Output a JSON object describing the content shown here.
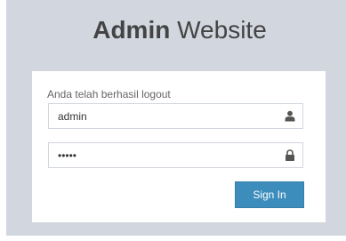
{
  "logo": {
    "bold": "Admin",
    "light": "Website"
  },
  "login": {
    "message": "Anda telah berhasil logout",
    "username_value": "admin",
    "password_value": "•••••",
    "signin_label": "Sign In"
  },
  "icons": {
    "username": "user-icon",
    "password": "lock-icon"
  },
  "colors": {
    "page_background": "#d2d6de",
    "box_background": "#ffffff",
    "button": "#3c8dbc",
    "title_text": "#444444"
  }
}
